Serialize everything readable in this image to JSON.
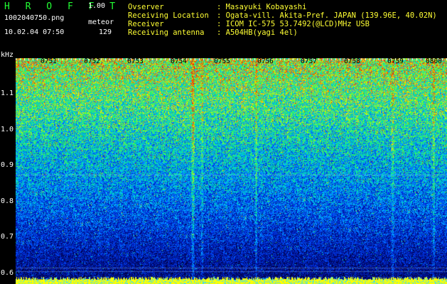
{
  "header": {
    "app_title": "H R O F F T",
    "app_version": "1.00",
    "file_name": "1002040750.png",
    "mode_label": "meteor",
    "timestamp": "10.02.04 07:50",
    "count": "129"
  },
  "info": [
    {
      "key": "Ovserver",
      "value": ": Masayuki Kobayashi"
    },
    {
      "key": "Receiving Location",
      "value": ": Ogata-vill. Akita-Pref. JAPAN (139.96E, 40.02N)"
    },
    {
      "key": "Receiver",
      "value": ": ICOM IC-575 53.7492(@LCD)MHz USB"
    },
    {
      "key": "Receiving antenna",
      "value": ": A504HB(yagi 4el)"
    }
  ],
  "colors": {
    "title": "#22ff33",
    "info_text": "#ffff33",
    "background": "#000000"
  },
  "spectrogram": {
    "unit": "kHz",
    "freq_ticks": [
      "1.1",
      "1.0",
      "0.9",
      "0.8",
      "0.7",
      "0.6"
    ],
    "freq_values": [
      1.1,
      1.0,
      0.9,
      0.8,
      0.7,
      0.6
    ],
    "freq_range": [
      0.57,
      1.2
    ],
    "time_ticks": [
      "0751",
      "0752",
      "0753",
      "0754",
      "0755",
      "0756",
      "0757",
      "0758",
      "0759",
      "0800"
    ],
    "time_range": [
      "0750",
      "0800"
    ]
  }
}
